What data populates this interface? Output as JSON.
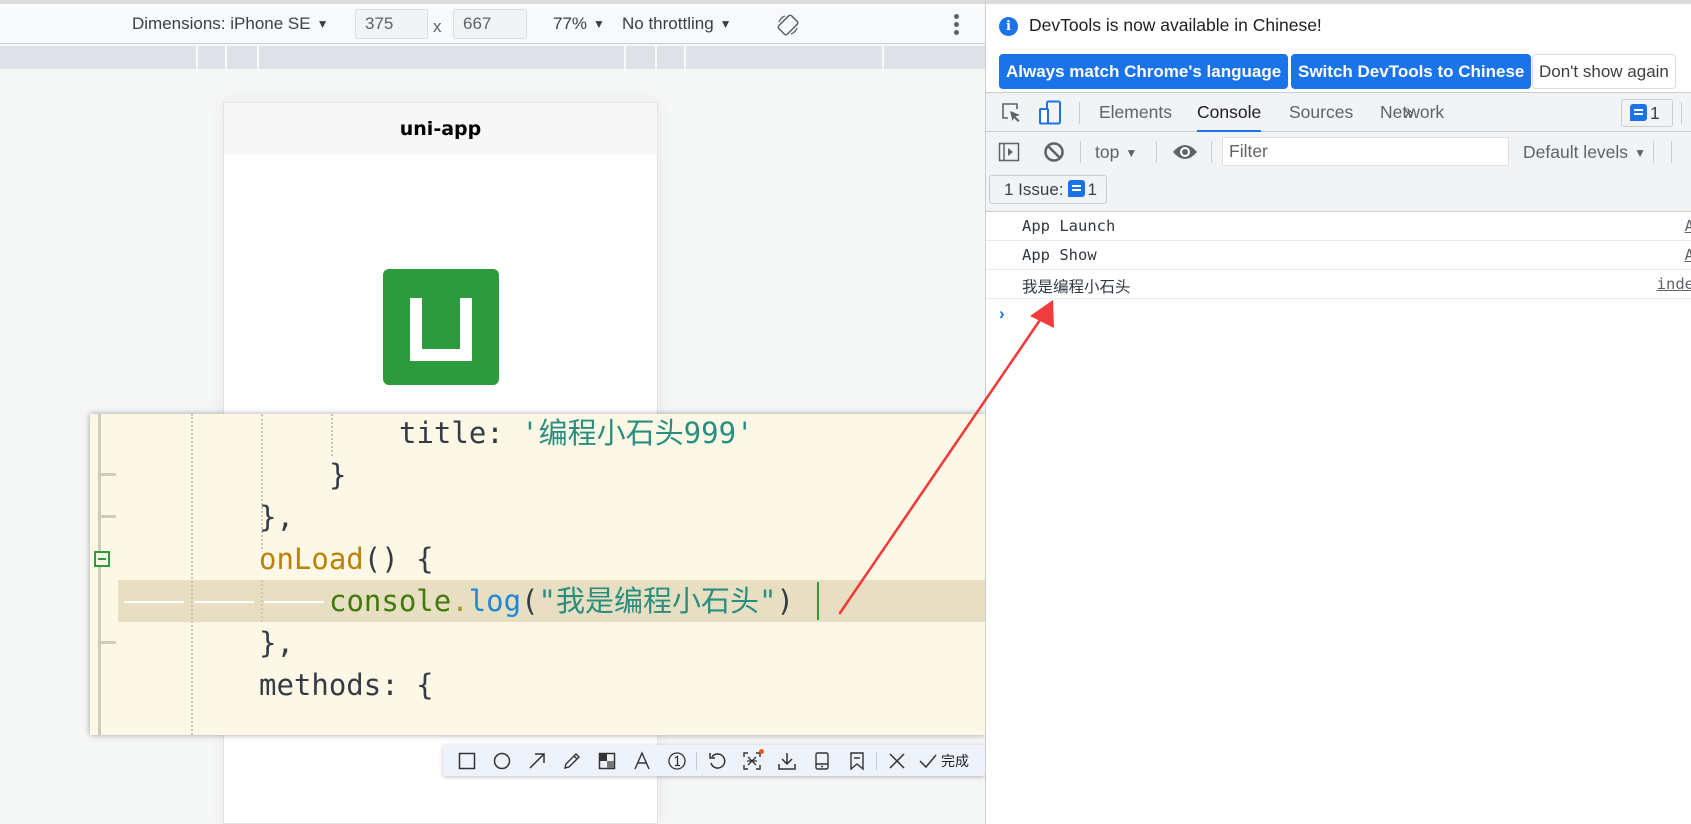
{
  "emulator": {
    "device_label": "Dimensions: iPhone SE",
    "width": "375",
    "x_sep": "x",
    "height": "667",
    "zoom": "77%",
    "throttle": "No throttling",
    "rotate_icon": "rotate-device-icon",
    "more_icon": "more-vertical-icon"
  },
  "phone": {
    "nav_title": "uni-app",
    "logo": "uni-app-logo",
    "logo_color": "#2d9a3d"
  },
  "code_editor": {
    "lines": [
      {
        "indent": 4,
        "tokens": [
          {
            "t": "title: ",
            "c": "plain"
          },
          {
            "t": "'编程小石头999'",
            "c": "str"
          }
        ]
      },
      {
        "indent": 3,
        "tokens": [
          {
            "t": "}",
            "c": "plain"
          }
        ]
      },
      {
        "indent": 2,
        "tokens": [
          {
            "t": "},",
            "c": "plain"
          }
        ]
      },
      {
        "indent": 2,
        "tokens": [
          {
            "t": "onLoad",
            "c": "fn"
          },
          {
            "t": "() {",
            "c": "plain"
          }
        ]
      },
      {
        "indent": 3,
        "tokens": [
          {
            "t": "console",
            "c": "obj"
          },
          {
            "t": ".",
            "c": "dot"
          },
          {
            "t": "log",
            "c": "meth"
          },
          {
            "t": "(",
            "c": "plain"
          },
          {
            "t": "\"我是编程小石头\"",
            "c": "str"
          },
          {
            "t": ")",
            "c": "plain"
          }
        ]
      },
      {
        "indent": 2,
        "tokens": [
          {
            "t": "},",
            "c": "plain"
          }
        ]
      },
      {
        "indent": 2,
        "tokens": [
          {
            "t": "methods: {",
            "c": "plain"
          }
        ]
      }
    ],
    "active_line_index": 4,
    "highlight_color": "#e8dec1",
    "background_color": "#fdf8e6"
  },
  "snip_toolbar": {
    "tools": [
      "rectangle-icon",
      "ellipse-icon",
      "arrow-icon",
      "pencil-icon",
      "mosaic-icon",
      "text-icon",
      "number-marker-icon",
      "undo-icon",
      "ocr-icon",
      "download-icon",
      "pin-icon",
      "bookmark-icon",
      "close-icon"
    ],
    "done_label": "完成"
  },
  "devtools": {
    "info_message": "DevTools is now available in Chinese!",
    "buttons": {
      "match_language": "Always match Chrome's language",
      "switch_chinese": "Switch DevTools to Chinese",
      "dont_show": "Don't show again"
    },
    "tabs": [
      {
        "label": "Elements",
        "active": false
      },
      {
        "label": "Console",
        "active": true
      },
      {
        "label": "Sources",
        "active": false
      },
      {
        "label": "Network",
        "active": false
      }
    ],
    "more_tabs": "»",
    "issues_badge_count": "1",
    "console_toolbar": {
      "context": "top",
      "filter_placeholder": "Filter",
      "levels": "Default levels"
    },
    "issue_bar": {
      "label": "1 Issue:",
      "count": "1"
    },
    "messages": [
      {
        "text": "App Launch",
        "source": "A"
      },
      {
        "text": "App Show",
        "source": "A"
      },
      {
        "text": "我是编程小石头",
        "source": "inde"
      }
    ],
    "prompt": "›",
    "accent_color": "#1a73e8"
  },
  "annotation": {
    "type": "arrow",
    "color": "#f03c3c",
    "from": "console.log line in editor",
    "to": "console message 我是编程小石头"
  }
}
